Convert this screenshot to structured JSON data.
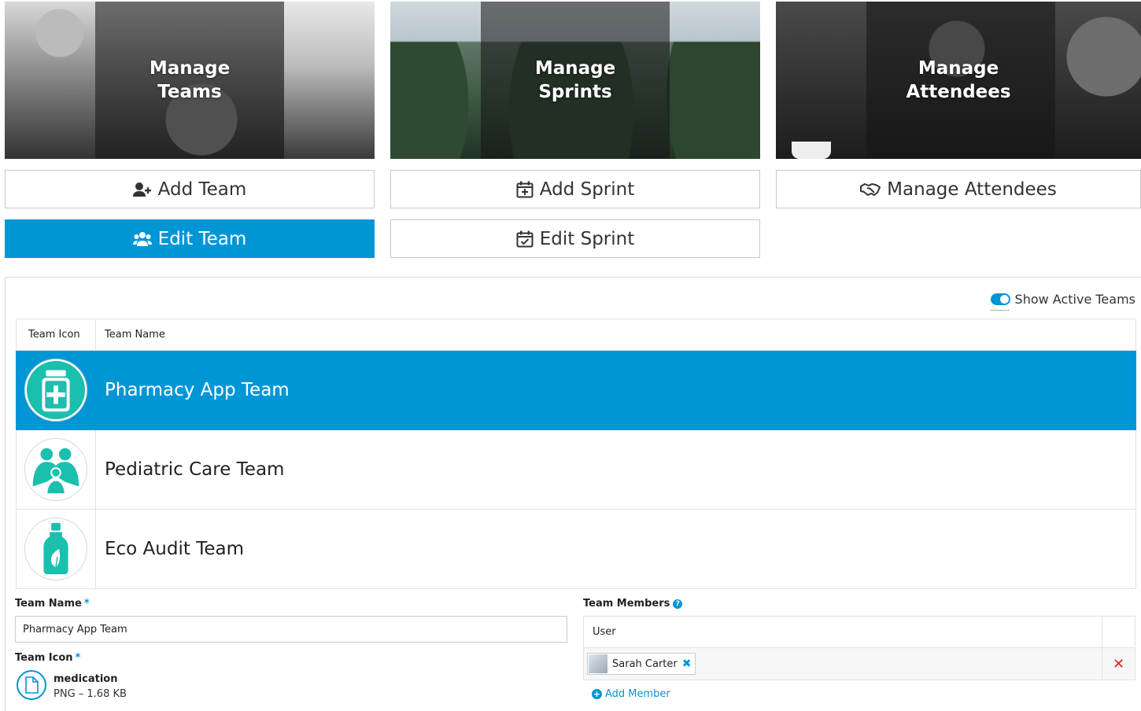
{
  "tiles": {
    "teams": "Manage Teams",
    "sprints": "Manage Sprints",
    "attendees": "Manage Attendees"
  },
  "actions": {
    "add_team": "Add Team",
    "edit_team": "Edit Team",
    "add_sprint": "Add Sprint",
    "edit_sprint": "Edit Sprint",
    "manage_attendees": "Manage Attendees",
    "active": "edit_team"
  },
  "toggle": {
    "label": "Show Active Teams",
    "on": true
  },
  "table": {
    "columns": [
      "Team Icon",
      "Team Name"
    ],
    "rows": [
      {
        "name": "Pharmacy App Team",
        "icon": "medicine-jar-icon",
        "selected": true
      },
      {
        "name": "Pediatric Care Team",
        "icon": "family-icon",
        "selected": false
      },
      {
        "name": "Eco Audit Team",
        "icon": "eco-bottle-icon",
        "selected": false
      }
    ]
  },
  "form": {
    "team_name_label": "Team Name",
    "team_name_value": "Pharmacy App Team",
    "team_icon_label": "Team Icon",
    "file_name": "medication",
    "file_meta": "PNG – 1.68 KB",
    "required_mark": "*",
    "members_label": "Team Members",
    "members_help": "?",
    "user_column": "User",
    "members": [
      {
        "name": "Sarah Carter"
      }
    ],
    "add_member": "Add Member"
  },
  "colors": {
    "accent": "#0096d6",
    "icon_teal": "#1bbfae",
    "remove": "#dd2222"
  }
}
